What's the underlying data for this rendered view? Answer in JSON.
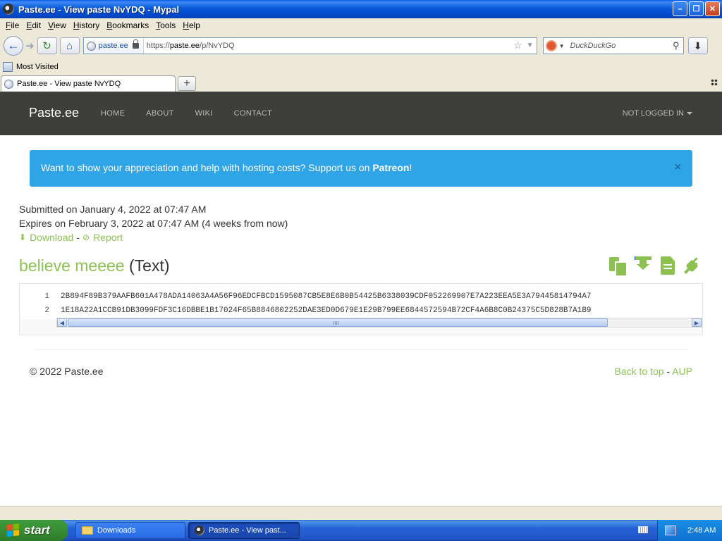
{
  "window": {
    "title": "Paste.ee - View paste NvYDQ - Mypal",
    "buttons": [
      "minimize",
      "maximize",
      "close"
    ]
  },
  "menu": {
    "items": [
      {
        "label": "File",
        "key": "F",
        "rest": "ile"
      },
      {
        "label": "Edit",
        "key": "E",
        "rest": "dit"
      },
      {
        "label": "View",
        "key": "V",
        "rest": "iew"
      },
      {
        "label": "History",
        "key": "H",
        "rest": "istory"
      },
      {
        "label": "Bookmarks",
        "key": "B",
        "rest": "ookmarks"
      },
      {
        "label": "Tools",
        "key": "T",
        "rest": "ools"
      },
      {
        "label": "Help",
        "key": "H",
        "rest": "elp"
      }
    ]
  },
  "navbar": {
    "site_identity": "paste.ee",
    "url_prefix": "https://",
    "url_host": "paste.ee",
    "url_path": "/p/NvYDQ",
    "search_placeholder": "DuckDuckGo"
  },
  "bookmarks": {
    "items": [
      "Most Visited"
    ]
  },
  "tabs": [
    {
      "label": "Paste.ee - View paste NvYDQ",
      "active": true
    }
  ],
  "site": {
    "brand": "Paste.ee",
    "nav": [
      "HOME",
      "ABOUT",
      "WIKI",
      "CONTACT"
    ],
    "account": "NOT LOGGED IN"
  },
  "alert": {
    "text": "Want to show your appreciation and help with hosting costs? Support us on ",
    "link": "Patreon",
    "suffix": "!",
    "close": "×"
  },
  "paste": {
    "submitted": "Submitted on January 4, 2022 at 07:47 AM",
    "expires": "Expires on February 3, 2022 at 07:47 AM (4 weeks from now)",
    "download_label": "Download",
    "separator": "-",
    "report_label": "Report",
    "title": "believe meeee",
    "language": "(Text)",
    "lines": [
      {
        "num": "1",
        "text": "2B894F89B379AAFB601A478ADA14063A4A56F96EDCFBCD1595087CB5E8E6B0B54425B6338039CDF052269907E7A223EEA5E3A79445814794A7"
      },
      {
        "num": "2",
        "text": "1E18A22A1CCB91DB3099FDF3C16DBBE1B17024F65B8846802252DAE3ED0D679E1E29B799EE6844572594B72CF4A6B8C0B24375C5D828B7A1B9"
      }
    ]
  },
  "footer": {
    "copyright": "© 2022 Paste.ee",
    "back_to_top": "Back to top",
    "separator": "-",
    "aup": "AUP"
  },
  "taskbar": {
    "start_label": "start",
    "tasks": [
      {
        "label": "Downloads",
        "active": false
      },
      {
        "label": "Paste.ee - View past...",
        "active": true
      }
    ],
    "clock": "2:48 AM"
  },
  "colors": {
    "accent_green": "#8cc152",
    "alert_blue": "#2fa4e7",
    "site_nav_bg": "#3e3e3b"
  }
}
